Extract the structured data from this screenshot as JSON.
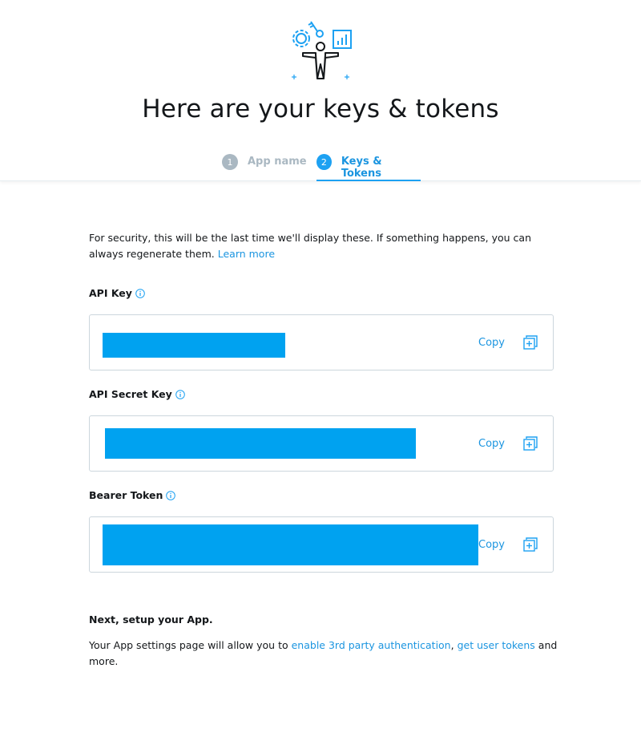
{
  "header": {
    "title": "Here are your keys & tokens",
    "hero_icon": "developer-keys-illustration",
    "steps": [
      {
        "number": "1",
        "label": "App name",
        "state": "inactive"
      },
      {
        "number": "2",
        "label": "Keys & Tokens",
        "state": "active"
      }
    ]
  },
  "intro": {
    "text": "For security, this will be the last time we'll display these. If something happens, you can always regenerate them.",
    "link": "Learn more"
  },
  "keys": [
    {
      "label": "API Key",
      "value": "",
      "copy_label": "Copy"
    },
    {
      "label": "API Secret Key",
      "value": "",
      "copy_label": "Copy"
    },
    {
      "label": "Bearer Token",
      "value": "",
      "copy_label": "Copy"
    }
  ],
  "next": {
    "title": "Next, setup your App.",
    "text_before": "Your App settings page will allow you to",
    "link1": "enable 3rd party authentication",
    "separator": ",",
    "link2": "get user tokens",
    "text_after": "and more."
  },
  "colors": {
    "accent": "#1da1f2",
    "link": "#1b95e0",
    "redaction": "#00a2f0",
    "muted": "#aab8c2"
  }
}
